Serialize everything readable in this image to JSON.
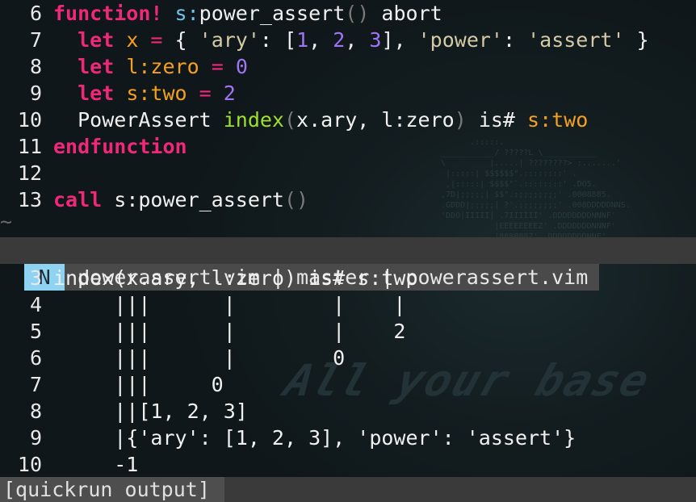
{
  "editor": {
    "lines": [
      {
        "num": "6",
        "segments": [
          {
            "t": "function!",
            "c": "kw"
          },
          {
            "t": " ",
            "c": ""
          },
          {
            "t": "s:",
            "c": "scope"
          },
          {
            "t": "power_assert",
            "c": ""
          },
          {
            "t": "()",
            "c": "paren"
          },
          {
            "t": " abort",
            "c": ""
          }
        ]
      },
      {
        "num": "7",
        "segments": [
          {
            "t": "  ",
            "c": ""
          },
          {
            "t": "let",
            "c": "kw"
          },
          {
            "t": " x ",
            "c": "var"
          },
          {
            "t": "=",
            "c": "op"
          },
          {
            "t": " { ",
            "c": ""
          },
          {
            "t": "'ary'",
            "c": "str"
          },
          {
            "t": ": [",
            "c": ""
          },
          {
            "t": "1",
            "c": "numv"
          },
          {
            "t": ", ",
            "c": ""
          },
          {
            "t": "2",
            "c": "numv"
          },
          {
            "t": ", ",
            "c": ""
          },
          {
            "t": "3",
            "c": "numv"
          },
          {
            "t": "], ",
            "c": ""
          },
          {
            "t": "'power'",
            "c": "str"
          },
          {
            "t": ": ",
            "c": ""
          },
          {
            "t": "'assert'",
            "c": "str"
          },
          {
            "t": " }",
            "c": ""
          }
        ]
      },
      {
        "num": "8",
        "segments": [
          {
            "t": "  ",
            "c": ""
          },
          {
            "t": "let",
            "c": "kw"
          },
          {
            "t": " l:zero ",
            "c": "var"
          },
          {
            "t": "=",
            "c": "op"
          },
          {
            "t": " ",
            "c": ""
          },
          {
            "t": "0",
            "c": "numv"
          }
        ]
      },
      {
        "num": "9",
        "segments": [
          {
            "t": "  ",
            "c": ""
          },
          {
            "t": "let",
            "c": "kw"
          },
          {
            "t": " s:two ",
            "c": "var"
          },
          {
            "t": "=",
            "c": "op"
          },
          {
            "t": " ",
            "c": ""
          },
          {
            "t": "2",
            "c": "numv"
          }
        ]
      },
      {
        "num": "10",
        "segments": [
          {
            "t": "  PowerAssert ",
            "c": ""
          },
          {
            "t": "index",
            "c": "fn"
          },
          {
            "t": "(",
            "c": "paren"
          },
          {
            "t": "x.ary, l:zero",
            "c": ""
          },
          {
            "t": ")",
            "c": "paren"
          },
          {
            "t": " is# ",
            "c": ""
          },
          {
            "t": "s:two",
            "c": "var"
          }
        ]
      },
      {
        "num": "11",
        "segments": [
          {
            "t": "endfunction",
            "c": "kw"
          }
        ]
      },
      {
        "num": "12",
        "segments": []
      },
      {
        "num": "13",
        "segments": [
          {
            "t": "call",
            "c": "kw"
          },
          {
            "t": " s:power_assert",
            "c": ""
          },
          {
            "t": "()",
            "c": "paren"
          }
        ]
      }
    ],
    "tilde": "~"
  },
  "statusline": {
    "mode": "N",
    "text": "powerassert.vim | master | powerassert.vim"
  },
  "output": {
    "lines": [
      {
        "num": "3",
        "text": "index(x.ary, l:zero) is# s:two"
      },
      {
        "num": "4",
        "text": "     |||      |        |    |"
      },
      {
        "num": "5",
        "text": "     |||      |        |    2"
      },
      {
        "num": "6",
        "text": "     |||      |        0"
      },
      {
        "num": "7",
        "text": "     |||     0"
      },
      {
        "num": "8",
        "text": "     ||[1, 2, 3]"
      },
      {
        "num": "9",
        "text": "     |{'ary': [1, 2, 3], 'power': 'assert'}"
      },
      {
        "num": "10",
        "text": "     -1"
      }
    ]
  },
  "bottom_status": {
    "text": "[quickrun output]"
  },
  "background": {
    "title": "All your base"
  }
}
